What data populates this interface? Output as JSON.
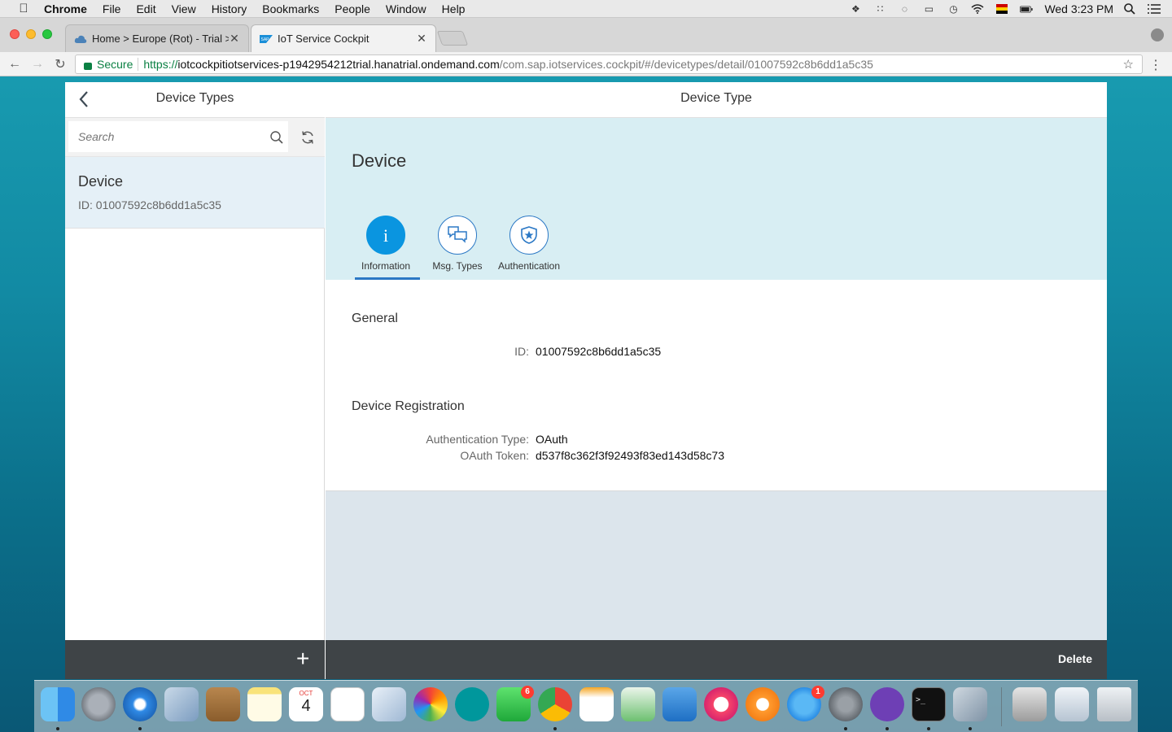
{
  "menubar": {
    "app": "Chrome",
    "items": [
      "File",
      "Edit",
      "View",
      "History",
      "Bookmarks",
      "People",
      "Window",
      "Help"
    ],
    "clock": "Wed 3:23 PM"
  },
  "browser": {
    "tabs": [
      {
        "title": "Home > Europe (Rot) - Trial >",
        "active": false
      },
      {
        "title": "IoT Service Cockpit",
        "active": true
      }
    ],
    "secure_label": "Secure",
    "url_scheme": "https://",
    "url_host": "iotcockpitiotservices-p1942954212trial.hanatrial.ondemand.com",
    "url_path": "/com.sap.iotservices.cockpit/#/devicetypes/detail/01007592c8b6dd1a5c35"
  },
  "master": {
    "title": "Device Types",
    "search_placeholder": "Search",
    "items": [
      {
        "title": "Device",
        "description": "ID: 01007592c8b6dd1a5c35"
      }
    ],
    "add_label": "+"
  },
  "detail": {
    "title": "Device Type",
    "object_title": "Device",
    "tabs": [
      {
        "label": "Information",
        "icon": "info-icon",
        "selected": true
      },
      {
        "label": "Msg. Types",
        "icon": "chat-icon",
        "selected": false
      },
      {
        "label": "Authentication",
        "icon": "shield-icon",
        "selected": false
      }
    ],
    "sections": {
      "general": {
        "title": "General",
        "id_label": "ID:",
        "id_value": "01007592c8b6dd1a5c35"
      },
      "registration": {
        "title": "Device Registration",
        "auth_type_label": "Authentication Type:",
        "auth_type_value": "OAuth",
        "token_label": "OAuth Token:",
        "token_value": "d537f8c362f3f92493f83ed143d58c73"
      }
    },
    "delete_label": "Delete"
  },
  "dock": {
    "badges": {
      "facetime": "6",
      "appstore": "1"
    },
    "calendar_month": "OCT",
    "calendar_day": "4"
  },
  "colors": {
    "accent": "#0a95e0",
    "header_bg": "#d8eef3",
    "footer_bg": "#3f4447",
    "selected_item_bg": "#e5f0f7"
  }
}
